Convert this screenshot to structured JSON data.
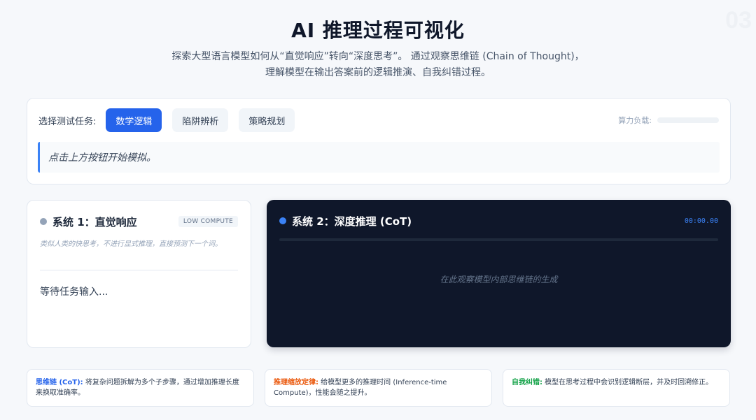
{
  "page_number": "03",
  "header": {
    "title": "AI 推理过程可视化",
    "subtitle_line1": "探索大型语言模型如何从“直觉响应”转向“深度思考”。 通过观察思维链 (Chain of Thought)，",
    "subtitle_line2": "理解模型在输出答案前的逻辑推演、自我纠错过程。"
  },
  "controls": {
    "task_label": "选择测试任务:",
    "tasks": [
      "数学逻辑",
      "陷阱辨析",
      "策略规划"
    ],
    "active_task": "数学逻辑",
    "load_label": "算力负载:",
    "load_level": 0,
    "prompt": "点击上方按钮开始模拟。"
  },
  "system1": {
    "title": "系统 1：直觉响应",
    "badge": "LOW COMPUTE",
    "description": "类似人类的快思考，不进行显式推理，直接预测下一个词。",
    "output": "等待任务输入..."
  },
  "system2": {
    "title": "系统 2：深度推理 (CoT)",
    "timer": "00:00.00",
    "progress": 0,
    "placeholder": "在此观察模型内部思维链的生成"
  },
  "notes": [
    {
      "term": "思维链 (CoT):",
      "text": " 将复杂问题拆解为多个子步骤，通过增加推理长度来换取准确率。",
      "color": "#2563eb"
    },
    {
      "term": "推理缩放定律:",
      "text": " 给模型更多的推理时间 (Inference-time Compute)，性能会随之提升。",
      "color": "#ea580c"
    },
    {
      "term": "自我纠错:",
      "text": " 模型在思考过程中会识别逻辑断层，并及时回溯修正。",
      "color": "#16a34a"
    }
  ],
  "colors": {
    "accent": "#2563eb",
    "dark_panel": "#0f172a",
    "system1_dot": "#94a3b8",
    "system2_dot": "#3b82f6"
  }
}
